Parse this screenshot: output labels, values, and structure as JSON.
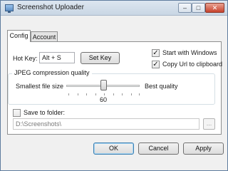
{
  "window": {
    "title": "Screenshot Uploader",
    "close_glyph": "✕",
    "min_glyph": "–",
    "max_glyph": "□"
  },
  "tabs": [
    {
      "label": "Config",
      "active": true
    },
    {
      "label": "Account",
      "active": false
    }
  ],
  "config": {
    "hotkey_label": "Hot Key:",
    "hotkey_value": "Alt + S",
    "set_key_label": "Set Key",
    "start_with_windows": {
      "label": "Start with Windows",
      "checked": true
    },
    "copy_url": {
      "label": "Copy Url to clipboard",
      "checked": true
    },
    "jpeg_group_title": "JPEG compression quality",
    "slider_min_label": "Smallest file size",
    "slider_max_label": "Best quality",
    "slider_value": "60",
    "save_to_folder": {
      "label": "Save to folder:",
      "checked": false
    },
    "folder_path": "D:\\Screenshots\\",
    "browse_label": "..."
  },
  "footer": {
    "ok_label": "OK",
    "cancel_label": "Cancel",
    "apply_label": "Apply"
  },
  "colors": {
    "accent": "#3c7fb1",
    "titlebar": "#c9d6e4",
    "close": "#c7422c"
  }
}
